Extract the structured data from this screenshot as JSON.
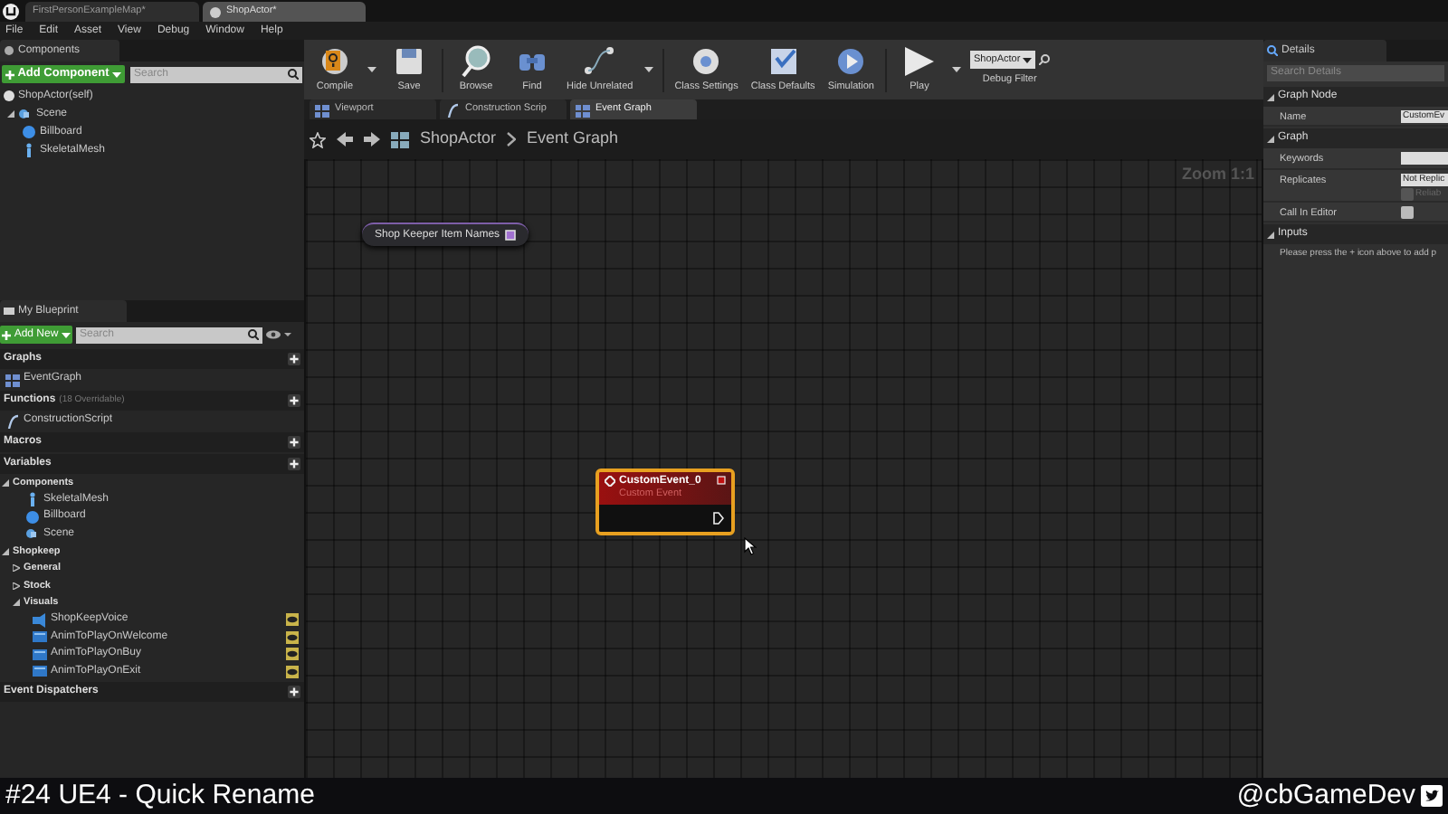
{
  "title_tabs": [
    {
      "label": "FirstPersonExampleMap*",
      "selected": false
    },
    {
      "label": "ShopActor*",
      "selected": true
    }
  ],
  "menu": [
    "File",
    "Edit",
    "Asset",
    "View",
    "Debug",
    "Window",
    "Help"
  ],
  "components": {
    "title": "Components",
    "add_button": "Add Component",
    "search": {
      "placeholder": "Search"
    },
    "root": "ShopActor(self)",
    "tree": [
      {
        "label": "Scene",
        "kind": "scene",
        "children": [
          {
            "label": "Billboard",
            "kind": "billboard"
          },
          {
            "label": "SkeletalMesh",
            "kind": "mesh"
          }
        ]
      }
    ]
  },
  "my_blueprint": {
    "title": "My Blueprint",
    "add_button": "Add New",
    "search": {
      "placeholder": "Search"
    },
    "sections": [
      {
        "label": "Graphs",
        "items": [
          {
            "label": "EventGraph",
            "kind": "graph"
          }
        ]
      },
      {
        "label": "Functions",
        "note": "(18 Overridable)",
        "items": [
          {
            "label": "ConstructionScript",
            "kind": "function"
          }
        ]
      },
      {
        "label": "Macros"
      },
      {
        "label": "Variables",
        "items": [
          {
            "label": "Components",
            "kind": "category",
            "expanded": true,
            "children": [
              {
                "label": "SkeletalMesh",
                "kind": "mesh",
                "public": false
              },
              {
                "label": "Billboard",
                "kind": "billboard",
                "public": false
              },
              {
                "label": "Scene",
                "kind": "scene",
                "public": false
              }
            ]
          },
          {
            "label": "Shopkeep",
            "kind": "category",
            "expanded": true,
            "children": [
              {
                "label": "General",
                "kind": "category",
                "expanded": false
              },
              {
                "label": "Stock",
                "kind": "category",
                "expanded": false
              },
              {
                "label": "Visuals",
                "kind": "category",
                "expanded": true,
                "children": [
                  {
                    "label": "ShopKeepVoice",
                    "kind": "sound",
                    "public": true
                  },
                  {
                    "label": "AnimToPlayOnWelcome",
                    "kind": "anim",
                    "public": true
                  },
                  {
                    "label": "AnimToPlayOnBuy",
                    "kind": "anim",
                    "public": true
                  },
                  {
                    "label": "AnimToPlayOnExit",
                    "kind": "anim",
                    "public": true
                  }
                ]
              }
            ]
          }
        ]
      },
      {
        "label": "Event Dispatchers"
      }
    ]
  },
  "toolbar": [
    {
      "label": "Compile",
      "kind": "compile",
      "dropdown": true
    },
    {
      "label": "Save",
      "kind": "save",
      "dropdown": false
    },
    {
      "label": "Browse",
      "kind": "browse",
      "dropdown": false
    },
    {
      "label": "Find",
      "kind": "find",
      "dropdown": false
    },
    {
      "label": "Hide Unrelated",
      "kind": "hide",
      "dropdown": true
    },
    {
      "label": "Class Settings",
      "kind": "settings",
      "dropdown": false
    },
    {
      "label": "Class Defaults",
      "kind": "defaults",
      "dropdown": false
    },
    {
      "label": "Simulation",
      "kind": "simulation",
      "dropdown": false
    },
    {
      "label": "Play",
      "kind": "play",
      "dropdown": true
    }
  ],
  "debug_filter": {
    "value": "ShopActor",
    "label": "Debug Filter"
  },
  "graph_tabs": [
    {
      "label": "Viewport",
      "kind": "viewport",
      "selected": false
    },
    {
      "label": "Construction Scrip",
      "kind": "function",
      "selected": false
    },
    {
      "label": "Event Graph",
      "kind": "graph",
      "selected": true
    }
  ],
  "breadcrumb": [
    "ShopActor",
    "Event Graph"
  ],
  "zoom": "Zoom 1:1",
  "nodes": [
    {
      "kind": "variable",
      "label": "Shop Keeper Item Names"
    },
    {
      "kind": "event",
      "title": "CustomEvent_0",
      "subtitle": "Custom Event",
      "selected": true
    }
  ],
  "details": {
    "title": "Details",
    "search": {
      "placeholder": "Search Details"
    },
    "sections": [
      {
        "label": "Graph Node",
        "rows": [
          {
            "label": "Name",
            "kind": "text",
            "value": "CustomEv"
          }
        ]
      },
      {
        "label": "Graph",
        "rows": [
          {
            "label": "Keywords",
            "kind": "text"
          },
          {
            "label": "Replicates",
            "kind": "dropdown",
            "value": "Not Replic",
            "option": {
              "label": "Reliab",
              "checked": false,
              "disabled": true
            }
          },
          {
            "label": "Call In Editor",
            "kind": "checkbox",
            "checked": false
          }
        ]
      },
      {
        "label": "Inputs",
        "note": "Please press the + icon above to add p"
      }
    ]
  },
  "caption": {
    "title": "#24 UE4 - Quick Rename",
    "handle": "@cbGameDev"
  }
}
